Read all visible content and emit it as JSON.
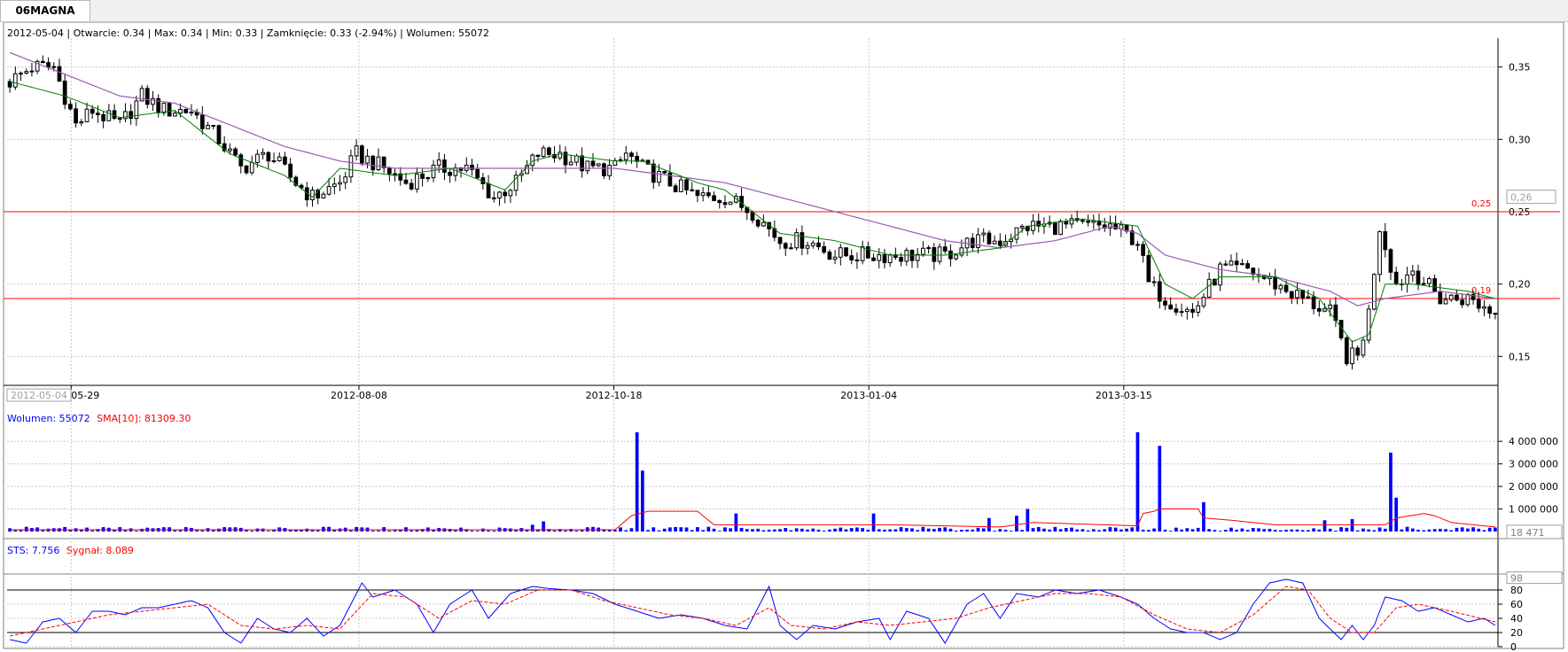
{
  "tab": {
    "label": "06MAGNA"
  },
  "info_bar": "2012-05-04 | Otwarcie: 0.34 | Max: 0.34 | Min: 0.33 | Zamknięcie: 0.33 (-2.94%)  | Wolumen: 55072",
  "volume_legend": {
    "volume": "Wolumen: 55072",
    "sma": "SMA[10]: 81309.30"
  },
  "sts_legend": {
    "sts": "STS: 7.756",
    "signal": "Sygnał: 8.089"
  },
  "colors": {
    "volume": "#0000ff",
    "sma": "#ff0000",
    "ma_short": "#008000",
    "ma_long": "#9b59b6",
    "grid": "#c8c8c8",
    "level": "#ff0000",
    "sts": "#0000ff",
    "signal": "#ff0000"
  },
  "chart_data": [
    {
      "type": "candlestick",
      "title": "",
      "ylim": [
        0.13,
        0.37
      ],
      "y_ticks": [
        "0,35",
        "0,30",
        "0,25",
        "0,20",
        "0,15"
      ],
      "x_ticks": [
        "2012-05-29",
        "2012-08-08",
        "2012-10-18",
        "2013-01-04",
        "2013-03-15"
      ],
      "cursor_date": "2012-05-04",
      "price_label": "0,26",
      "levels": [
        {
          "value": 0.25,
          "label": "0,25"
        },
        {
          "value": 0.19,
          "label": "0,19"
        }
      ],
      "close_anchors": [
        [
          0,
          0.34
        ],
        [
          4,
          0.35
        ],
        [
          8,
          0.35
        ],
        [
          12,
          0.31
        ],
        [
          15,
          0.32
        ],
        [
          20,
          0.31
        ],
        [
          24,
          0.33
        ],
        [
          28,
          0.32
        ],
        [
          33,
          0.32
        ],
        [
          38,
          0.3
        ],
        [
          42,
          0.28
        ],
        [
          47,
          0.29
        ],
        [
          52,
          0.27
        ],
        [
          55,
          0.26
        ],
        [
          60,
          0.27
        ],
        [
          63,
          0.29
        ],
        [
          68,
          0.28
        ],
        [
          72,
          0.27
        ],
        [
          78,
          0.28
        ],
        [
          83,
          0.28
        ],
        [
          88,
          0.26
        ],
        [
          92,
          0.27
        ],
        [
          96,
          0.29
        ],
        [
          100,
          0.29
        ],
        [
          105,
          0.28
        ],
        [
          110,
          0.28
        ],
        [
          112,
          0.29
        ],
        [
          115,
          0.28
        ],
        [
          120,
          0.27
        ],
        [
          125,
          0.26
        ],
        [
          130,
          0.26
        ],
        [
          135,
          0.25
        ],
        [
          140,
          0.23
        ],
        [
          145,
          0.23
        ],
        [
          150,
          0.22
        ],
        [
          155,
          0.22
        ],
        [
          160,
          0.22
        ],
        [
          165,
          0.22
        ],
        [
          170,
          0.22
        ],
        [
          175,
          0.23
        ],
        [
          180,
          0.23
        ],
        [
          185,
          0.24
        ],
        [
          190,
          0.24
        ],
        [
          195,
          0.24
        ],
        [
          200,
          0.24
        ],
        [
          205,
          0.23
        ],
        [
          207,
          0.2
        ],
        [
          210,
          0.19
        ],
        [
          215,
          0.18
        ],
        [
          220,
          0.21
        ],
        [
          225,
          0.21
        ],
        [
          230,
          0.2
        ],
        [
          235,
          0.19
        ],
        [
          240,
          0.18
        ],
        [
          243,
          0.15
        ],
        [
          245,
          0.15
        ],
        [
          247,
          0.18
        ],
        [
          249,
          0.24
        ],
        [
          252,
          0.2
        ],
        [
          255,
          0.21
        ],
        [
          260,
          0.19
        ],
        [
          265,
          0.19
        ],
        [
          270,
          0.18
        ]
      ],
      "ma_short_anchors": [
        [
          0,
          0.34
        ],
        [
          10,
          0.33
        ],
        [
          20,
          0.315
        ],
        [
          30,
          0.32
        ],
        [
          40,
          0.29
        ],
        [
          50,
          0.275
        ],
        [
          55,
          0.26
        ],
        [
          60,
          0.28
        ],
        [
          70,
          0.275
        ],
        [
          80,
          0.28
        ],
        [
          90,
          0.265
        ],
        [
          95,
          0.285
        ],
        [
          100,
          0.29
        ],
        [
          110,
          0.285
        ],
        [
          115,
          0.285
        ],
        [
          125,
          0.27
        ],
        [
          130,
          0.265
        ],
        [
          140,
          0.235
        ],
        [
          150,
          0.23
        ],
        [
          160,
          0.22
        ],
        [
          170,
          0.22
        ],
        [
          180,
          0.225
        ],
        [
          185,
          0.24
        ],
        [
          195,
          0.245
        ],
        [
          205,
          0.24
        ],
        [
          210,
          0.2
        ],
        [
          215,
          0.19
        ],
        [
          220,
          0.205
        ],
        [
          230,
          0.205
        ],
        [
          238,
          0.19
        ],
        [
          244,
          0.16
        ],
        [
          247,
          0.165
        ],
        [
          250,
          0.2
        ],
        [
          255,
          0.2
        ],
        [
          265,
          0.195
        ],
        [
          270,
          0.19
        ]
      ],
      "ma_long_anchors": [
        [
          0,
          0.36
        ],
        [
          10,
          0.345
        ],
        [
          20,
          0.33
        ],
        [
          30,
          0.325
        ],
        [
          40,
          0.31
        ],
        [
          50,
          0.295
        ],
        [
          60,
          0.285
        ],
        [
          70,
          0.28
        ],
        [
          80,
          0.28
        ],
        [
          90,
          0.28
        ],
        [
          100,
          0.28
        ],
        [
          110,
          0.28
        ],
        [
          120,
          0.275
        ],
        [
          130,
          0.27
        ],
        [
          140,
          0.26
        ],
        [
          150,
          0.25
        ],
        [
          160,
          0.24
        ],
        [
          170,
          0.23
        ],
        [
          180,
          0.225
        ],
        [
          190,
          0.23
        ],
        [
          200,
          0.24
        ],
        [
          205,
          0.235
        ],
        [
          210,
          0.22
        ],
        [
          220,
          0.21
        ],
        [
          230,
          0.205
        ],
        [
          240,
          0.195
        ],
        [
          245,
          0.185
        ],
        [
          250,
          0.19
        ],
        [
          260,
          0.195
        ],
        [
          270,
          0.19
        ]
      ],
      "n": 271
    },
    {
      "type": "bar",
      "title": "",
      "ylim": [
        0,
        4400000
      ],
      "y_ticks": [
        "4 000 000",
        "3 000 000",
        "2 000 000",
        "1 000 000"
      ],
      "value_label": "18 471",
      "spikes": [
        [
          114,
          4400000
        ],
        [
          115,
          2700000
        ],
        [
          205,
          4400000
        ],
        [
          209,
          3800000
        ],
        [
          217,
          1300000
        ],
        [
          251,
          3500000
        ],
        [
          252,
          1500000
        ],
        [
          132,
          800000
        ],
        [
          157,
          800000
        ],
        [
          183,
          700000
        ],
        [
          178,
          600000
        ],
        [
          185,
          1000000
        ],
        [
          97,
          450000
        ],
        [
          95,
          300000
        ],
        [
          239,
          500000
        ],
        [
          244,
          550000
        ],
        [
          10,
          200000
        ]
      ],
      "sma_anchors": [
        [
          0,
          80000
        ],
        [
          110,
          80000
        ],
        [
          113,
          700000
        ],
        [
          116,
          900000
        ],
        [
          125,
          900000
        ],
        [
          128,
          300000
        ],
        [
          160,
          300000
        ],
        [
          180,
          200000
        ],
        [
          186,
          400000
        ],
        [
          205,
          250000
        ],
        [
          206,
          800000
        ],
        [
          208,
          900000
        ],
        [
          209,
          1000000
        ],
        [
          216,
          1000000
        ],
        [
          217,
          600000
        ],
        [
          222,
          500000
        ],
        [
          230,
          300000
        ],
        [
          250,
          300000
        ],
        [
          252,
          600000
        ],
        [
          257,
          800000
        ],
        [
          259,
          700000
        ],
        [
          262,
          400000
        ],
        [
          270,
          200000
        ]
      ]
    },
    {
      "type": "line",
      "title": "",
      "ylim": [
        0,
        100
      ],
      "y_ticks": [
        "98",
        "80",
        "60",
        "40",
        "20",
        "0"
      ],
      "levels": [
        80,
        20
      ],
      "sts_anchors": [
        [
          0,
          10
        ],
        [
          3,
          5
        ],
        [
          6,
          35
        ],
        [
          9,
          40
        ],
        [
          12,
          20
        ],
        [
          15,
          50
        ],
        [
          18,
          50
        ],
        [
          21,
          45
        ],
        [
          24,
          55
        ],
        [
          27,
          55
        ],
        [
          30,
          60
        ],
        [
          33,
          65
        ],
        [
          36,
          55
        ],
        [
          39,
          20
        ],
        [
          42,
          5
        ],
        [
          45,
          40
        ],
        [
          48,
          25
        ],
        [
          51,
          20
        ],
        [
          54,
          40
        ],
        [
          57,
          15
        ],
        [
          60,
          30
        ],
        [
          64,
          90
        ],
        [
          66,
          70
        ],
        [
          70,
          80
        ],
        [
          74,
          60
        ],
        [
          77,
          20
        ],
        [
          80,
          60
        ],
        [
          84,
          80
        ],
        [
          87,
          40
        ],
        [
          91,
          75
        ],
        [
          95,
          85
        ],
        [
          98,
          82
        ],
        [
          102,
          80
        ],
        [
          106,
          75
        ],
        [
          110,
          60
        ],
        [
          114,
          50
        ],
        [
          118,
          40
        ],
        [
          122,
          45
        ],
        [
          126,
          40
        ],
        [
          130,
          30
        ],
        [
          134,
          25
        ],
        [
          138,
          85
        ],
        [
          140,
          30
        ],
        [
          143,
          10
        ],
        [
          146,
          30
        ],
        [
          150,
          25
        ],
        [
          154,
          35
        ],
        [
          158,
          40
        ],
        [
          160,
          10
        ],
        [
          163,
          50
        ],
        [
          167,
          40
        ],
        [
          170,
          5
        ],
        [
          174,
          60
        ],
        [
          177,
          75
        ],
        [
          180,
          40
        ],
        [
          183,
          75
        ],
        [
          187,
          70
        ],
        [
          190,
          80
        ],
        [
          194,
          75
        ],
        [
          198,
          80
        ],
        [
          202,
          70
        ],
        [
          205,
          60
        ],
        [
          208,
          40
        ],
        [
          211,
          25
        ],
        [
          214,
          20
        ],
        [
          217,
          20
        ],
        [
          220,
          10
        ],
        [
          223,
          20
        ],
        [
          226,
          60
        ],
        [
          229,
          90
        ],
        [
          232,
          95
        ],
        [
          235,
          90
        ],
        [
          238,
          40
        ],
        [
          240,
          25
        ],
        [
          242,
          10
        ],
        [
          244,
          30
        ],
        [
          246,
          10
        ],
        [
          248,
          30
        ],
        [
          250,
          70
        ],
        [
          253,
          65
        ],
        [
          256,
          50
        ],
        [
          259,
          55
        ],
        [
          262,
          45
        ],
        [
          265,
          35
        ],
        [
          268,
          40
        ],
        [
          270,
          30
        ]
      ],
      "signal_anchors": [
        [
          0,
          15
        ],
        [
          6,
          25
        ],
        [
          12,
          35
        ],
        [
          18,
          45
        ],
        [
          24,
          50
        ],
        [
          30,
          55
        ],
        [
          36,
          60
        ],
        [
          42,
          30
        ],
        [
          48,
          25
        ],
        [
          54,
          30
        ],
        [
          60,
          25
        ],
        [
          66,
          75
        ],
        [
          72,
          70
        ],
        [
          78,
          40
        ],
        [
          84,
          65
        ],
        [
          90,
          60
        ],
        [
          96,
          80
        ],
        [
          102,
          80
        ],
        [
          108,
          65
        ],
        [
          114,
          55
        ],
        [
          120,
          45
        ],
        [
          126,
          40
        ],
        [
          132,
          30
        ],
        [
          138,
          55
        ],
        [
          142,
          30
        ],
        [
          148,
          25
        ],
        [
          154,
          35
        ],
        [
          160,
          30
        ],
        [
          166,
          35
        ],
        [
          172,
          40
        ],
        [
          178,
          55
        ],
        [
          184,
          65
        ],
        [
          190,
          75
        ],
        [
          196,
          75
        ],
        [
          202,
          70
        ],
        [
          208,
          45
        ],
        [
          214,
          25
        ],
        [
          220,
          20
        ],
        [
          226,
          45
        ],
        [
          232,
          85
        ],
        [
          236,
          80
        ],
        [
          240,
          40
        ],
        [
          244,
          20
        ],
        [
          248,
          20
        ],
        [
          252,
          55
        ],
        [
          256,
          60
        ],
        [
          262,
          50
        ],
        [
          270,
          35
        ]
      ]
    }
  ]
}
